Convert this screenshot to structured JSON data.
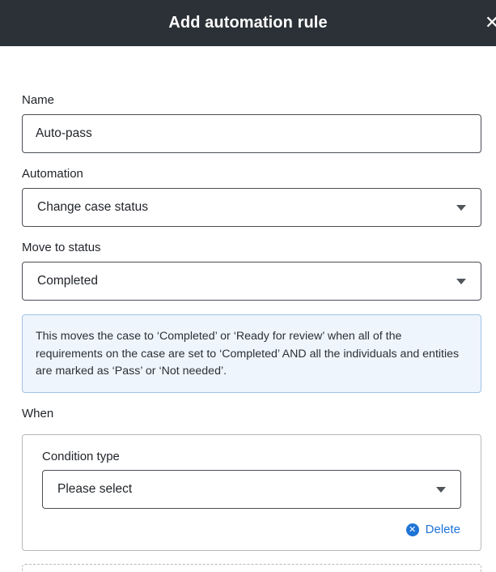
{
  "header": {
    "title": "Add automation rule",
    "close_icon": "close-icon"
  },
  "form": {
    "name": {
      "label": "Name",
      "value": "Auto-pass"
    },
    "automation": {
      "label": "Automation",
      "selected": "Change case status"
    },
    "move_to_status": {
      "label": "Move to status",
      "selected": "Completed"
    },
    "info_text": "This moves the case to ‘Completed’ or ‘Ready for review’ when all of the requirements on the case are set to ‘Completed’ AND all the individuals and entities are marked as ‘Pass’ or ‘Not needed’.",
    "when": {
      "label": "When",
      "condition": {
        "label": "Condition type",
        "selected": "Please select",
        "delete_label": "Delete"
      }
    }
  },
  "colors": {
    "header_bg": "#2b3136",
    "accent": "#1f74d6",
    "info_bg": "#eef5fc",
    "info_border": "#9fc3e8"
  }
}
